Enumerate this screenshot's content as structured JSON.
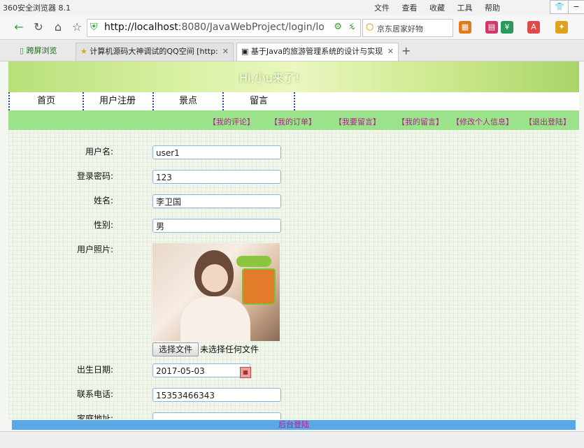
{
  "browser": {
    "app_title": "360安全浏览器 8.1",
    "menu": [
      "文件",
      "查看",
      "收藏",
      "工具",
      "帮助"
    ],
    "url_host": "http://localhost",
    "url_rest": ":8080/JavaWebProject/login/lo",
    "search_placeholder": "京东居家好物",
    "tabs": [
      {
        "label": "跨屏浏览"
      },
      {
        "label": "计算机源码大神调试的QQ空间 [http:"
      },
      {
        "label": "基于Java的旅游管理系统的设计与实现"
      }
    ]
  },
  "site": {
    "greeting": "Hi,小u来了!",
    "nav": [
      "首页",
      "用户注册",
      "景点",
      "留言"
    ],
    "subnav": [
      "【我的评论】",
      "【我的订单】",
      "【我要留言】",
      "【我的留言】",
      "【修改个人信息】",
      "【退出登陆】"
    ]
  },
  "form": {
    "username_label": "用户名:",
    "username_value": "user1",
    "password_label": "登录密码:",
    "password_value": "123",
    "name_label": "姓名:",
    "name_value": "李卫国",
    "gender_label": "性别:",
    "gender_value": "男",
    "photo_label": "用户照片:",
    "file_button": "选择文件",
    "file_status": "未选择任何文件",
    "birth_label": "出生日期:",
    "birth_value": "2017-05-03",
    "phone_label": "联系电话:",
    "phone_value": "15353466343",
    "address_label": "家庭地址:"
  },
  "footer": {
    "label": "后台登陆"
  }
}
